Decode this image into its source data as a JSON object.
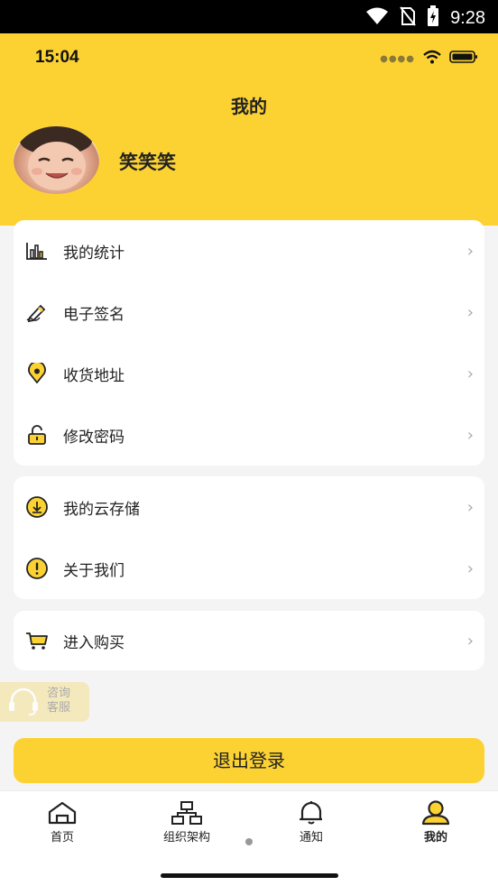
{
  "android_status": {
    "time": "9:28"
  },
  "ios_status": {
    "time": "15:04"
  },
  "header": {
    "title": "我的"
  },
  "profile": {
    "username": "笑笑笑"
  },
  "menu_group_1": [
    {
      "label": "我的统计",
      "icon": "bar-chart-icon"
    },
    {
      "label": "电子签名",
      "icon": "pen-icon"
    },
    {
      "label": "收货地址",
      "icon": "location-pin-icon"
    },
    {
      "label": "修改密码",
      "icon": "lock-icon"
    }
  ],
  "menu_group_2": [
    {
      "label": "我的云存储",
      "icon": "cloud-download-icon"
    },
    {
      "label": "关于我们",
      "icon": "info-alert-icon"
    }
  ],
  "menu_group_3": [
    {
      "label": "进入购买",
      "icon": "cart-icon"
    }
  ],
  "consult": {
    "line1": "咨询",
    "line2": "客服"
  },
  "logout": {
    "label": "退出登录"
  },
  "tabbar": {
    "items": [
      {
        "label": "首页",
        "icon": "home-icon"
      },
      {
        "label": "组织架构",
        "icon": "org-chart-icon"
      },
      {
        "label": "通知",
        "icon": "bell-icon"
      },
      {
        "label": "我的",
        "icon": "user-icon",
        "active": true
      }
    ]
  },
  "colors": {
    "accent": "#fcd233",
    "background": "#f4f4f4"
  }
}
